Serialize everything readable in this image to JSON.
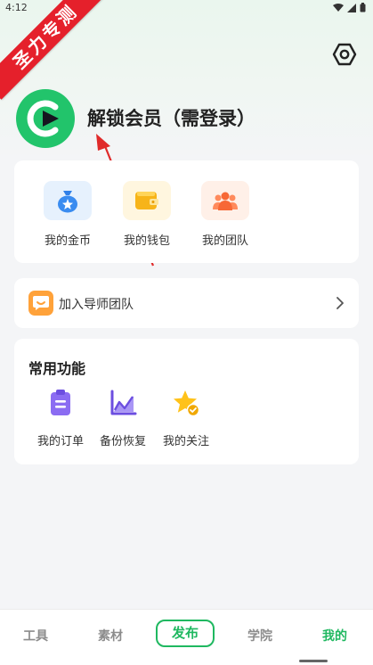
{
  "status_bar": {
    "time": "4:12"
  },
  "watermark": {
    "text": "圣力专测"
  },
  "profile": {
    "unlock_title": "解锁会员（需登录）"
  },
  "quick_items": [
    {
      "label": "我的金币",
      "icon": "coin-bag-icon"
    },
    {
      "label": "我的钱包",
      "icon": "wallet-icon"
    },
    {
      "label": "我的团队",
      "icon": "team-icon"
    }
  ],
  "mentor": {
    "label": "加入导师团队",
    "icon": "chat-bubble-icon"
  },
  "functions": {
    "title": "常用功能",
    "items": [
      {
        "label": "我的订单",
        "icon": "clipboard-icon"
      },
      {
        "label": "备份恢复",
        "icon": "chart-icon"
      },
      {
        "label": "我的关注",
        "icon": "star-icon"
      }
    ]
  },
  "tabs": {
    "tools": "工具",
    "materials": "素材",
    "publish": "发布",
    "academy": "学院",
    "mine": "我的"
  },
  "colors": {
    "accent": "#1fb860",
    "banner": "#e5202b",
    "arrow": "#e02a2a"
  }
}
